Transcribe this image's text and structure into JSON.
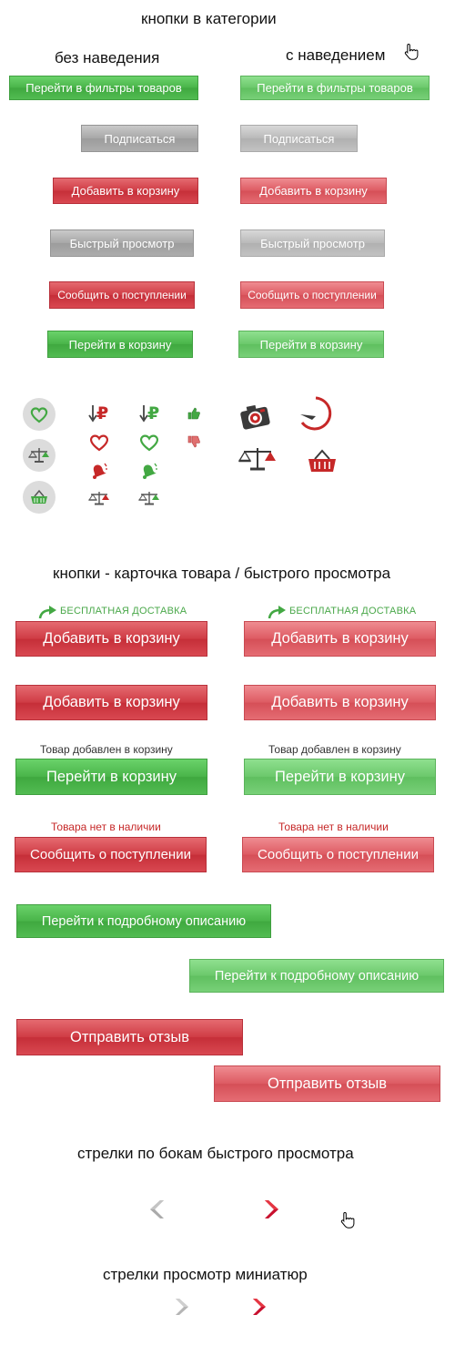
{
  "sections": {
    "category": "кнопки в категории",
    "no_hover": "без наведения",
    "hover": "с наведением",
    "product": "кнопки - карточка товара / быстрого просмотра",
    "quick_arrows": "стрелки по бокам быстрого просмотра",
    "thumb_arrows": "стрелки просмотр миниатюр"
  },
  "category_buttons": {
    "filters": "Перейти в фильтры товаров",
    "subscribe": "Подписаться",
    "add_to_cart": "Добавить в корзину",
    "quick_view": "Быстрый просмотр",
    "notify": "Сообщить о поступлении",
    "go_to_cart": "Перейти в корзину"
  },
  "icons": {
    "ruble": "₽"
  },
  "product_buttons": {
    "free_delivery": "БЕСПЛАТНАЯ ДОСТАВКА",
    "add_to_cart": "Добавить в корзину",
    "added_note": "Товар добавлен в корзину",
    "go_to_cart": "Перейти в корзину",
    "out_of_stock": "Товара нет в наличии",
    "notify": "Сообщить о поступлении",
    "details": "Перейти к подробному описанию",
    "review": "Отправить отзыв"
  },
  "colors": {
    "green": "#49b449",
    "red": "#cf3b44",
    "gray": "#a7a7a7",
    "arrow_red": "#c8102e"
  }
}
